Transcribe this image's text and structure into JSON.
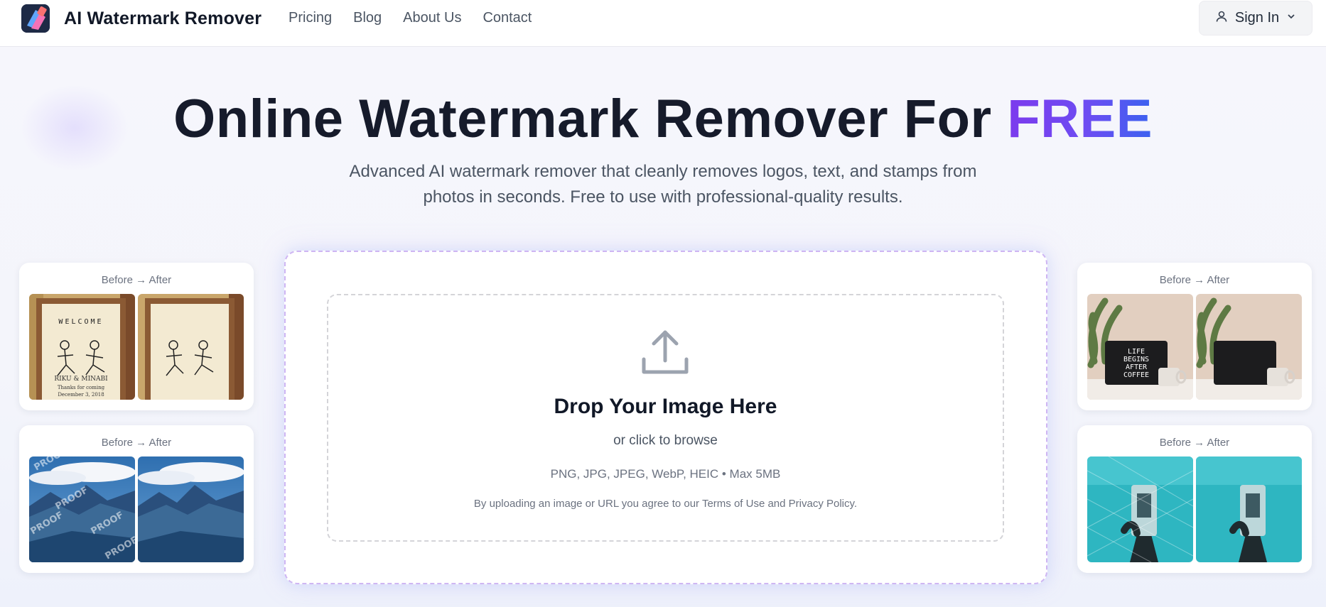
{
  "nav": {
    "brand": "AI Watermark Remover",
    "links": [
      "Pricing",
      "Blog",
      "About Us",
      "Contact"
    ],
    "signin_label": "Sign In",
    "icons": {
      "user": "user-icon",
      "chevron": "chevron-down-icon"
    }
  },
  "hero": {
    "title_main": "Online Watermark Remover For",
    "title_accent": "FREE",
    "subtitle_line1": "Advanced AI watermark remover that cleanly removes logos, text, and stamps from",
    "subtitle_line2": "photos in seconds. Free to use with professional-quality results."
  },
  "examples": [
    {
      "label": "Before → After",
      "image": "welcome-frame",
      "watermark": "WELCOME"
    },
    {
      "label": "Before → After",
      "image": "mountain-valley",
      "watermark": "PROOF"
    },
    {
      "label": "Before → After",
      "image": "letter-board",
      "watermark": "LIFE BEGINS AFTER COFFEE"
    },
    {
      "label": "Before → After",
      "image": "underwater-hand"
    }
  ],
  "upload": {
    "title": "Drop Your Image Here",
    "subtitle": "or click to browse",
    "formats": "PNG, JPG, JPEG, WebP, HEIC • Max 5MB",
    "terms": "By uploading an image or URL you agree to our Terms of Use and Privacy Policy.",
    "icon": "upload-icon"
  },
  "colors": {
    "accent_start": "#7c3aed",
    "accent_end": "#3b62f0",
    "title": "#161b2b",
    "muted": "#6b7280"
  }
}
